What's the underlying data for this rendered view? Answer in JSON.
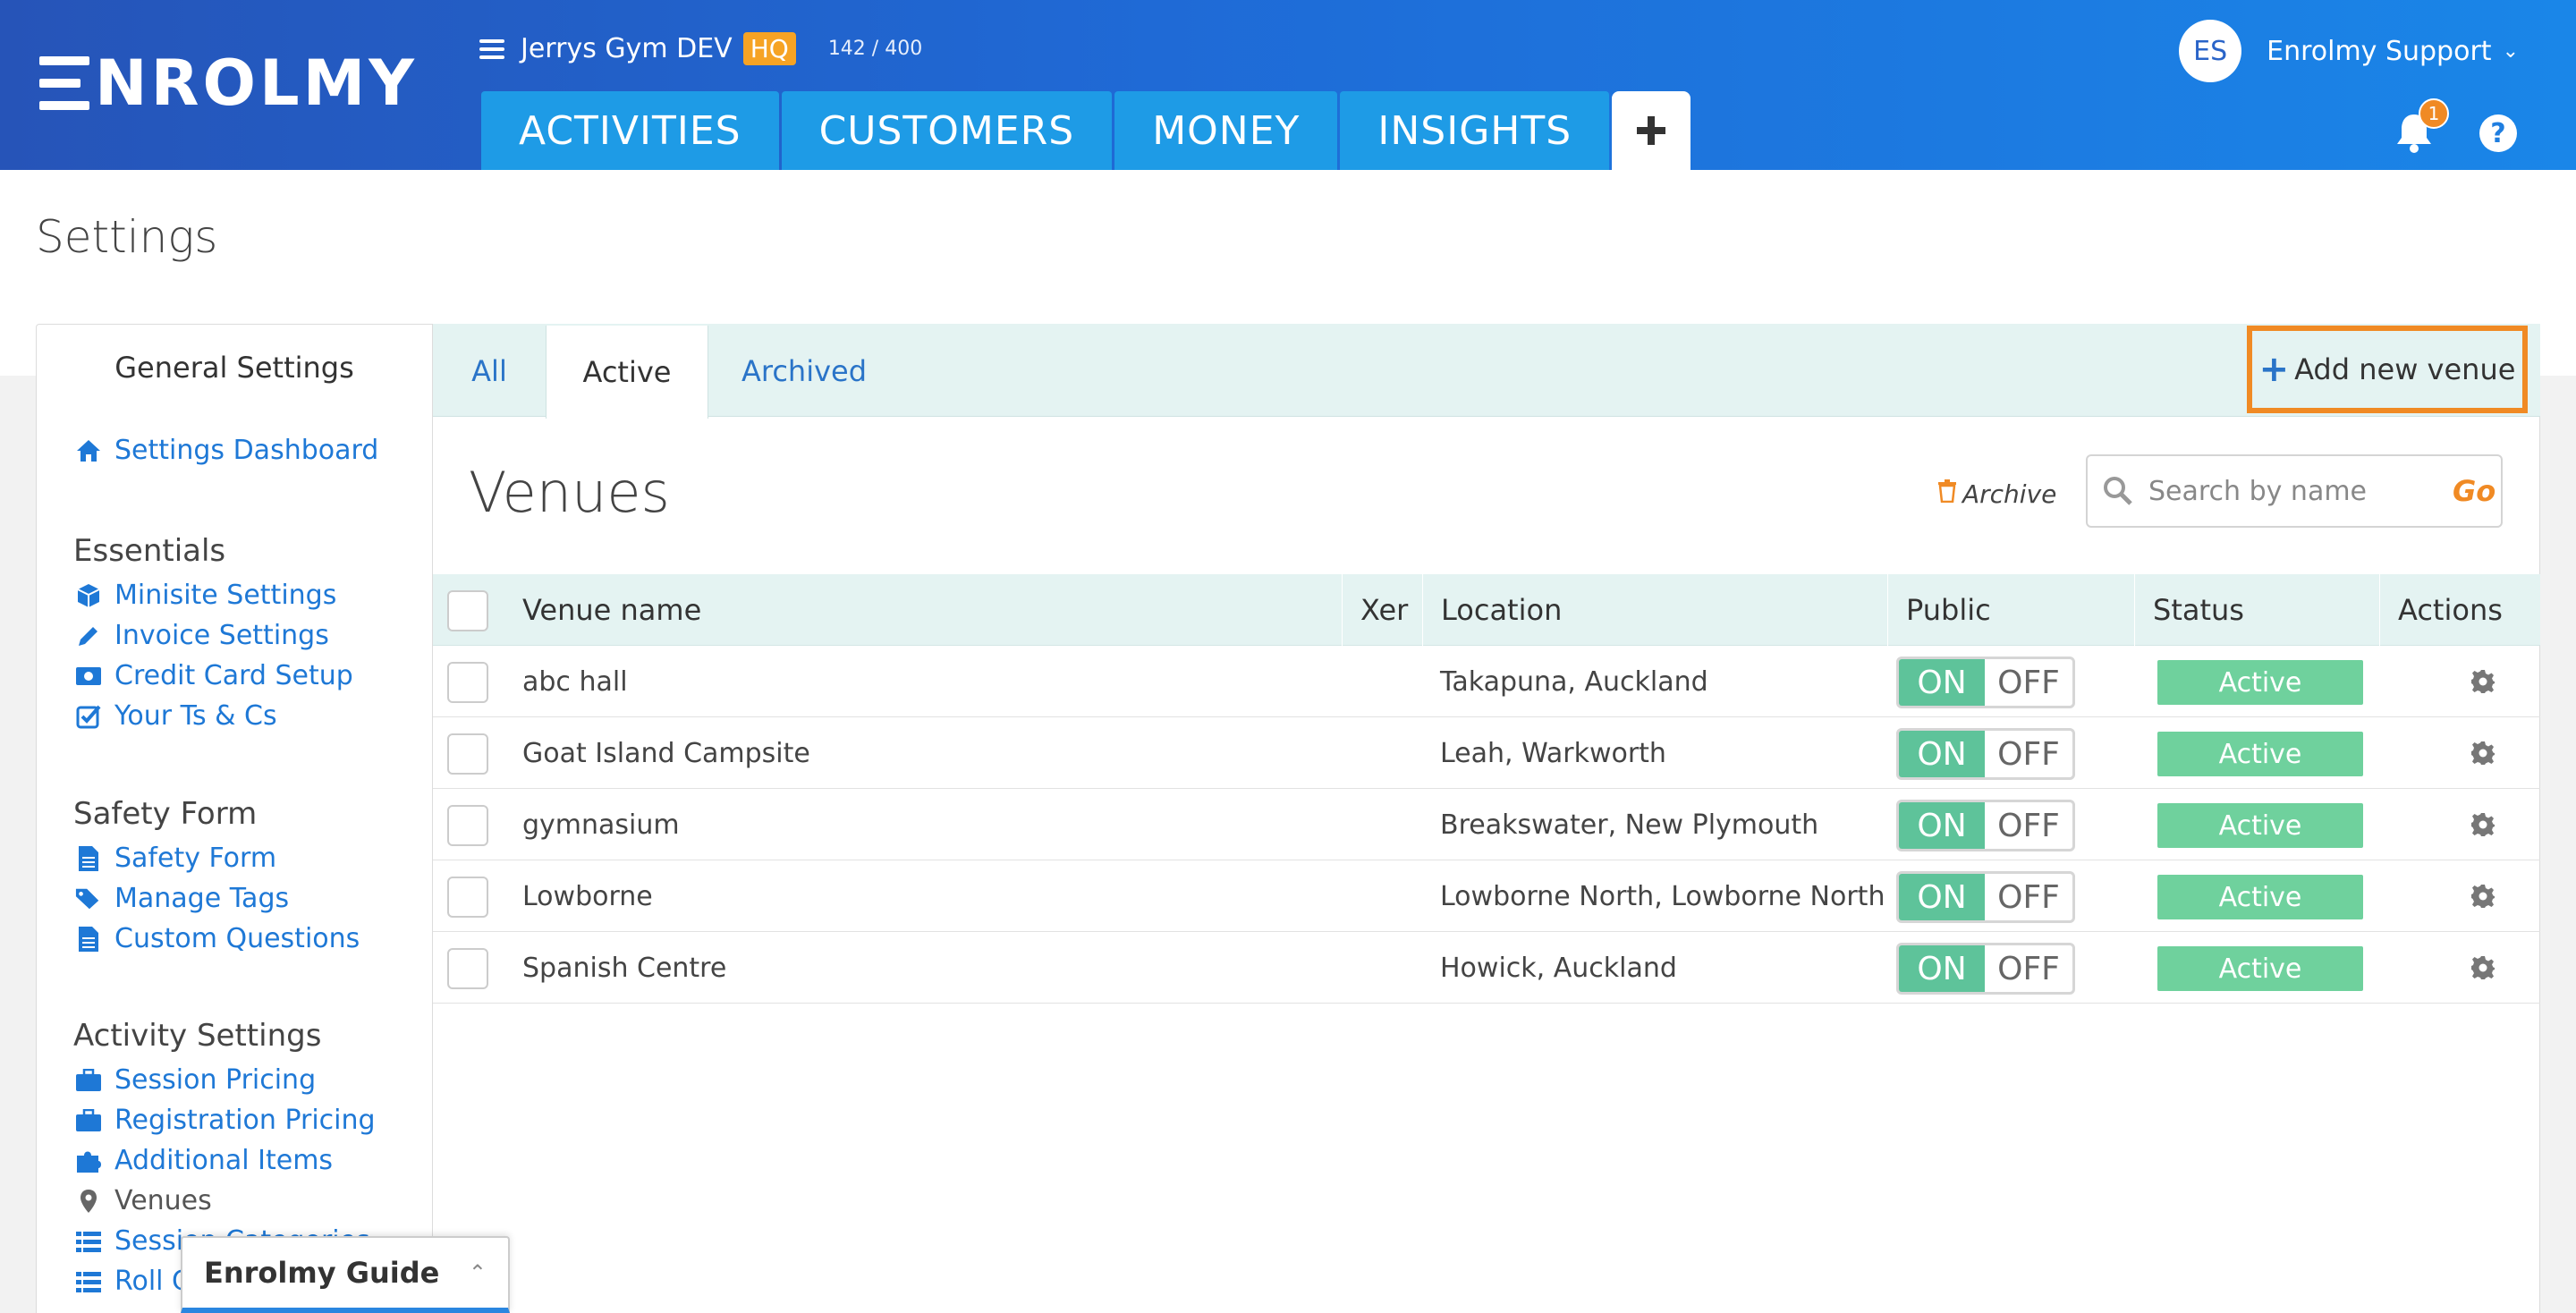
{
  "header": {
    "logo_text": "NROLMY",
    "org_name": "Jerrys Gym DEV",
    "org_badge": "HQ",
    "org_count": "142 / 400",
    "nav": [
      "ACTIVITIES",
      "CUSTOMERS",
      "MONEY",
      "INSIGHTS"
    ],
    "nav_plus": "+",
    "user_initials": "ES",
    "user_name": "Enrolmy Support",
    "notification_count": "1",
    "help": "?"
  },
  "page": {
    "title": "Settings"
  },
  "sidebar": {
    "heading": "General Settings",
    "dashboard": "Settings Dashboard",
    "groups": [
      {
        "title": "Essentials",
        "items": [
          "Minisite Settings",
          "Invoice Settings",
          "Credit Card Setup",
          "Your Ts & Cs"
        ]
      },
      {
        "title": "Safety Form",
        "items": [
          "Safety Form",
          "Manage Tags",
          "Custom Questions"
        ]
      },
      {
        "title": "Activity Settings",
        "items": [
          "Session Pricing",
          "Registration Pricing",
          "Additional Items",
          "Venues",
          "Session Categories",
          "Roll Call"
        ]
      }
    ]
  },
  "tabs": [
    "All",
    "Active",
    "Archived"
  ],
  "toolbar": {
    "add_label": "Add new venue",
    "section_title": "Venues",
    "archive_label": "Archive",
    "search_placeholder": "Search by name",
    "search_go": "Go"
  },
  "table": {
    "headers": [
      "Venue name",
      "Xer",
      "Location",
      "Public",
      "Status",
      "Actions"
    ],
    "toggle_on": "ON",
    "toggle_off": "OFF",
    "rows": [
      {
        "name": "abc hall",
        "xer": "",
        "location": "Takapuna, Auckland",
        "status": "Active"
      },
      {
        "name": "Goat Island Campsite",
        "xer": "",
        "location": "Leah, Warkworth",
        "status": "Active"
      },
      {
        "name": "gymnasium",
        "xer": "",
        "location": "Breakswater, New Plymouth",
        "status": "Active"
      },
      {
        "name": "Lowborne",
        "xer": "",
        "location": "Lowborne North, Lowborne North",
        "status": "Active"
      },
      {
        "name": "Spanish Centre",
        "xer": "",
        "location": "Howick, Auckland",
        "status": "Active"
      }
    ]
  },
  "guide": {
    "title": "Enrolmy Guide"
  },
  "colors": {
    "accent": "#1e9be6",
    "highlight": "#f08a24",
    "status_active": "#6fd19d",
    "toggle_on": "#5ec39a",
    "link": "#1e78d6"
  },
  "icons": {
    "dashboard": "home-icon",
    "essentials": [
      "cube-icon",
      "pencil-icon",
      "money-icon",
      "check-square-icon"
    ],
    "safety": [
      "document-icon",
      "tags-icon",
      "document-icon"
    ],
    "activity": [
      "briefcase-icon",
      "briefcase-icon",
      "puzzle-icon",
      "map-pin-icon",
      "list-icon",
      "list-icon"
    ]
  }
}
